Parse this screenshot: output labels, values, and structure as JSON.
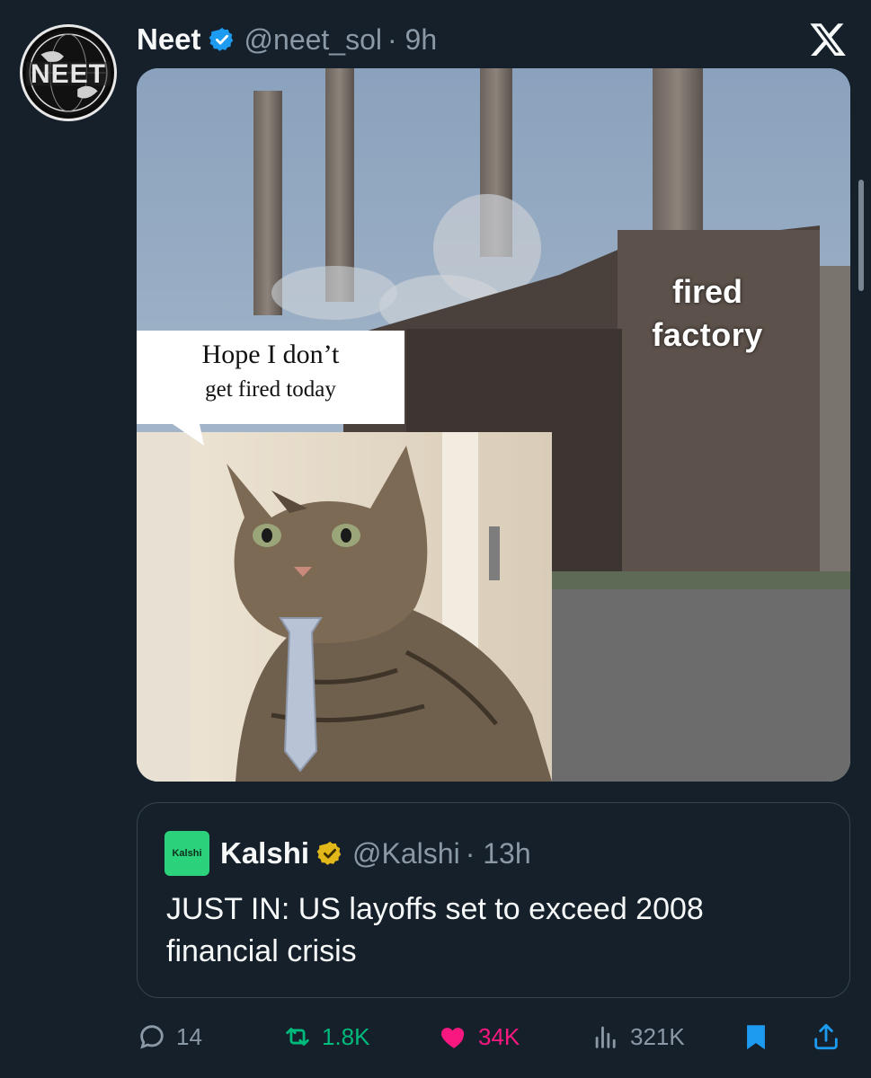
{
  "author": {
    "name": "Neet",
    "handle": "@neet_sol",
    "time": "· 9h",
    "avatar_text": "NEET",
    "verified": true
  },
  "media": {
    "caption_line1": "Hope I don’t",
    "caption_line2": "get fired today",
    "factory_line1": "fired",
    "factory_line2": "factory"
  },
  "quoted": {
    "logo_text": "Kalshi",
    "name": "Kalshi",
    "handle": "@Kalshi",
    "time": "· 13h",
    "text": "JUST IN: US layoffs set to exceed 2008 financial crisis"
  },
  "actions": {
    "replies": "14",
    "reposts": "1.8K",
    "likes": "34K",
    "views": "321K"
  },
  "colors": {
    "background": "#15202b",
    "verified_blue": "#1d9bf0",
    "verified_gold": "#e2b719",
    "repost_green": "#00ba7c",
    "like_pink": "#f91880",
    "bookmark_blue": "#1d9bf0",
    "kalshi_green": "#2bd27b"
  },
  "icons": [
    "reply-icon",
    "repost-icon",
    "like-icon",
    "views-icon",
    "bookmark-icon",
    "share-icon",
    "x-logo-icon",
    "verified-badge-icon"
  ]
}
